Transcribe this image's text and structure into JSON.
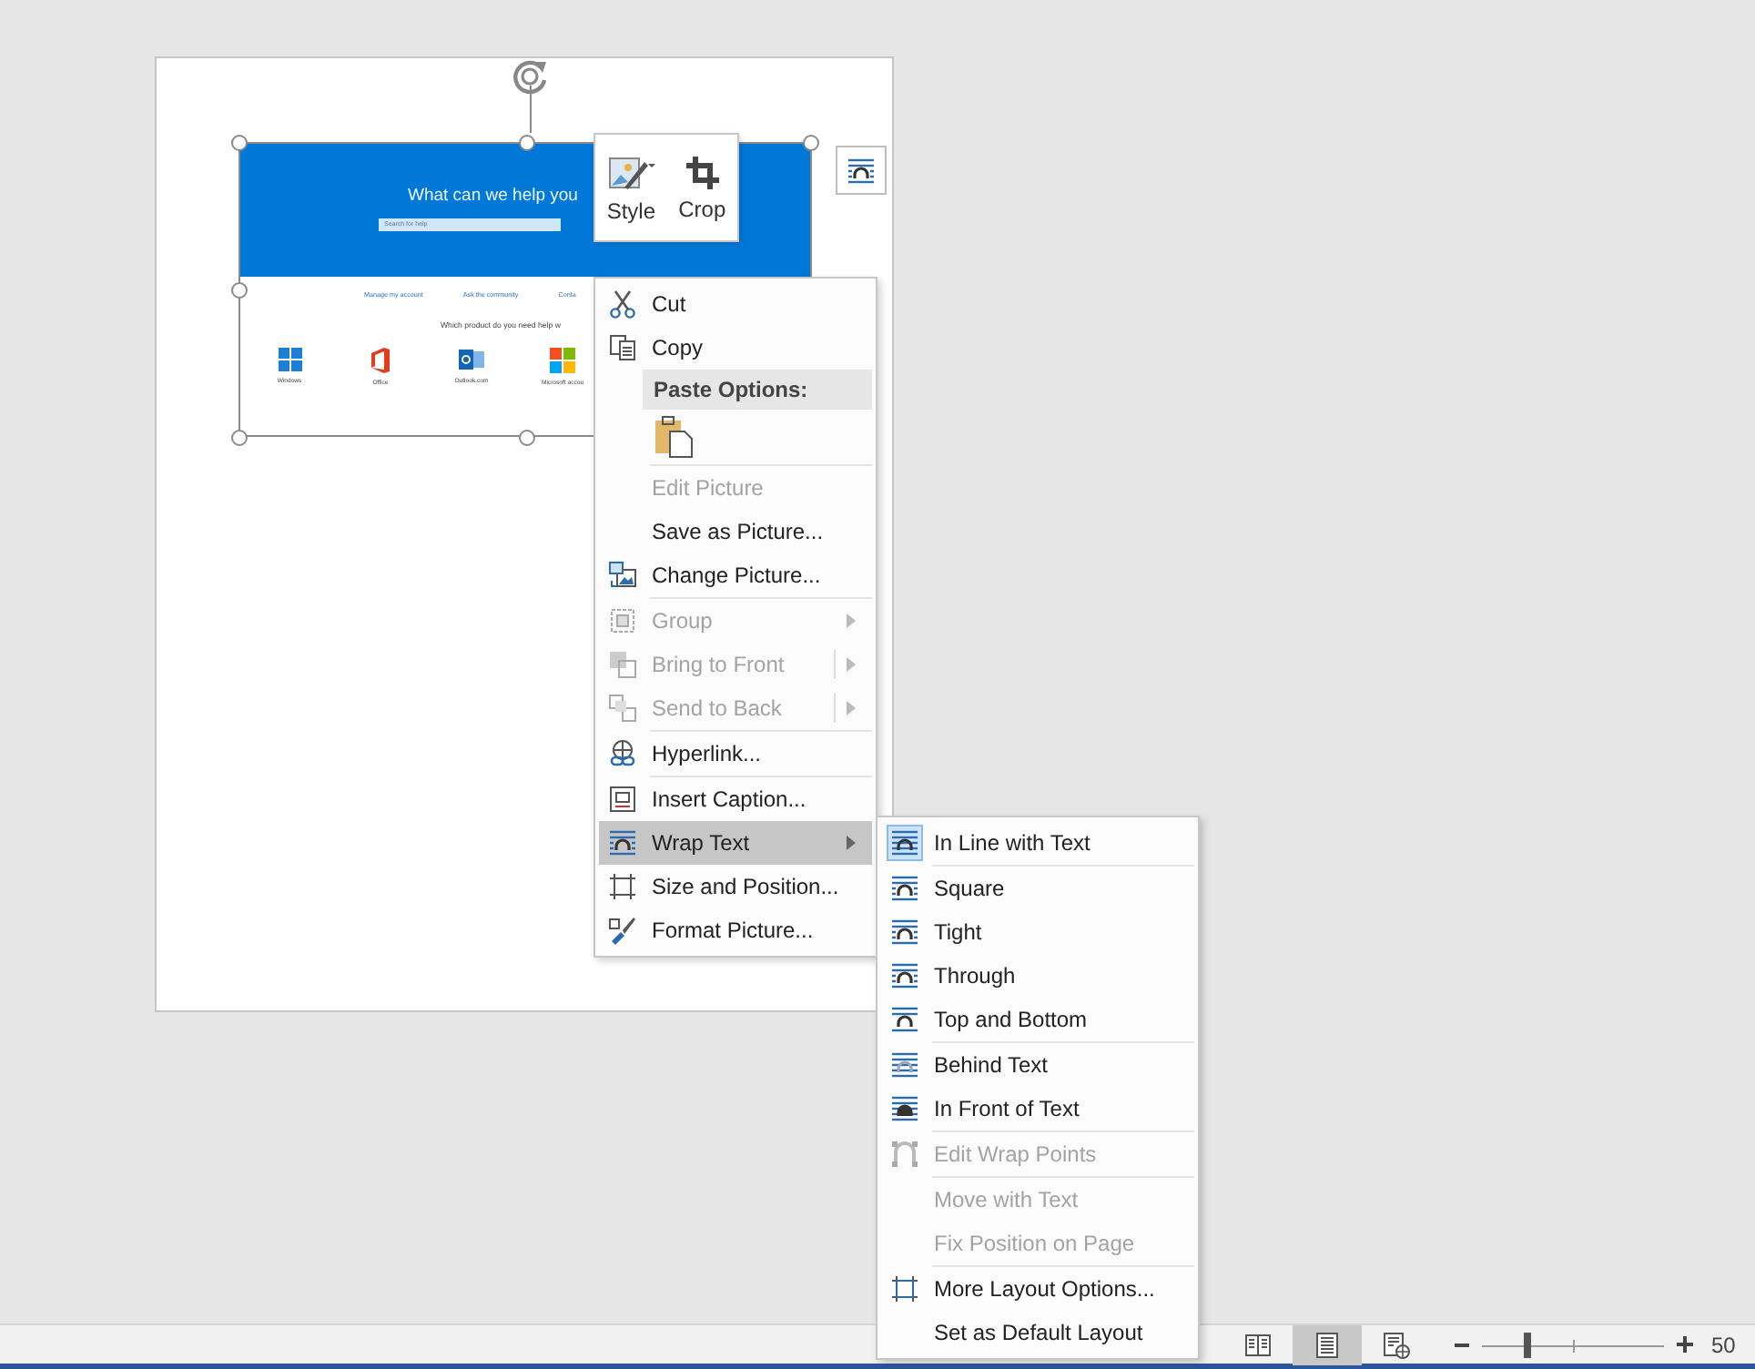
{
  "document": {
    "picture": {
      "headline": "What can we help you",
      "search_placeholder": "Search for help",
      "links": [
        "Manage my account",
        "Ask the community",
        "Conta"
      ],
      "question": "Which product do you need help w",
      "products": [
        {
          "kind": "windows",
          "label": "Windows"
        },
        {
          "kind": "office",
          "label": "Office"
        },
        {
          "kind": "outlook",
          "label": "Outlook.com"
        },
        {
          "kind": "microsoft",
          "label": "Microsoft accou"
        }
      ]
    }
  },
  "mini_toolbar": {
    "buttons": [
      {
        "kind": "style",
        "label": "Style"
      },
      {
        "kind": "crop",
        "label": "Crop"
      }
    ]
  },
  "context_menu": {
    "items": [
      {
        "kind": "cut",
        "label": "Cut",
        "disabled": false,
        "highlighted": false
      },
      {
        "kind": "copy",
        "label": "Copy",
        "disabled": false,
        "highlighted": false
      },
      {
        "kind": "header",
        "label": "Paste Options:"
      },
      {
        "kind": "paste"
      },
      {
        "kind": "separator"
      },
      {
        "kind": "plain",
        "label": "Edit Picture",
        "disabled": true,
        "highlighted": false
      },
      {
        "kind": "plain",
        "label": "Save as Picture...",
        "disabled": false,
        "highlighted": false
      },
      {
        "kind": "change",
        "label": "Change Picture...",
        "disabled": false,
        "highlighted": false
      },
      {
        "kind": "separator"
      },
      {
        "kind": "group",
        "label": "Group",
        "disabled": true,
        "highlighted": false,
        "has_submenu": true,
        "split": false
      },
      {
        "kind": "front",
        "label": "Bring to Front",
        "disabled": true,
        "highlighted": false,
        "has_submenu": true,
        "split": true
      },
      {
        "kind": "back",
        "label": "Send to Back",
        "disabled": true,
        "highlighted": false,
        "has_submenu": true,
        "split": true
      },
      {
        "kind": "separator"
      },
      {
        "kind": "link",
        "label": "Hyperlink...",
        "disabled": false,
        "highlighted": false
      },
      {
        "kind": "separator"
      },
      {
        "kind": "caption",
        "label": "Insert Caption...",
        "disabled": false,
        "highlighted": false
      },
      {
        "kind": "wrap",
        "label": "Wrap Text",
        "disabled": false,
        "highlighted": true,
        "has_submenu": true,
        "split": false
      },
      {
        "kind": "size",
        "label": "Size and Position...",
        "disabled": false,
        "highlighted": false
      },
      {
        "kind": "format",
        "label": "Format Picture...",
        "disabled": false,
        "highlighted": false
      }
    ]
  },
  "wrap_submenu": {
    "items": [
      {
        "kind": "inline",
        "label": "In Line with Text",
        "disabled": false,
        "selected": true
      },
      {
        "kind": "separator"
      },
      {
        "kind": "square",
        "label": "Square",
        "disabled": false,
        "selected": false
      },
      {
        "kind": "tight",
        "label": "Tight",
        "disabled": false,
        "selected": false
      },
      {
        "kind": "through",
        "label": "Through",
        "disabled": false,
        "selected": false
      },
      {
        "kind": "topbottom",
        "label": "Top and Bottom",
        "disabled": false,
        "selected": false
      },
      {
        "kind": "separator"
      },
      {
        "kind": "behind",
        "label": "Behind Text",
        "disabled": false,
        "selected": false
      },
      {
        "kind": "infront",
        "label": "In Front of Text",
        "disabled": false,
        "selected": false
      },
      {
        "kind": "separator"
      },
      {
        "kind": "points",
        "label": "Edit Wrap Points",
        "disabled": true,
        "selected": false
      },
      {
        "kind": "separator"
      },
      {
        "kind": "plain",
        "label": "Move with Text",
        "disabled": true,
        "selected": false
      },
      {
        "kind": "plain",
        "label": "Fix Position on Page",
        "disabled": true,
        "selected": false
      },
      {
        "kind": "separator"
      },
      {
        "kind": "layout",
        "label": "More Layout Options...",
        "disabled": false,
        "selected": false
      },
      {
        "kind": "plain",
        "label": "Set as Default Layout",
        "disabled": false,
        "selected": false
      }
    ]
  },
  "status_bar": {
    "views": [
      {
        "kind": "read",
        "selected": false
      },
      {
        "kind": "print",
        "selected": true
      },
      {
        "kind": "web",
        "selected": false
      }
    ],
    "zoom": {
      "level": 0.25,
      "percent": "50"
    }
  }
}
